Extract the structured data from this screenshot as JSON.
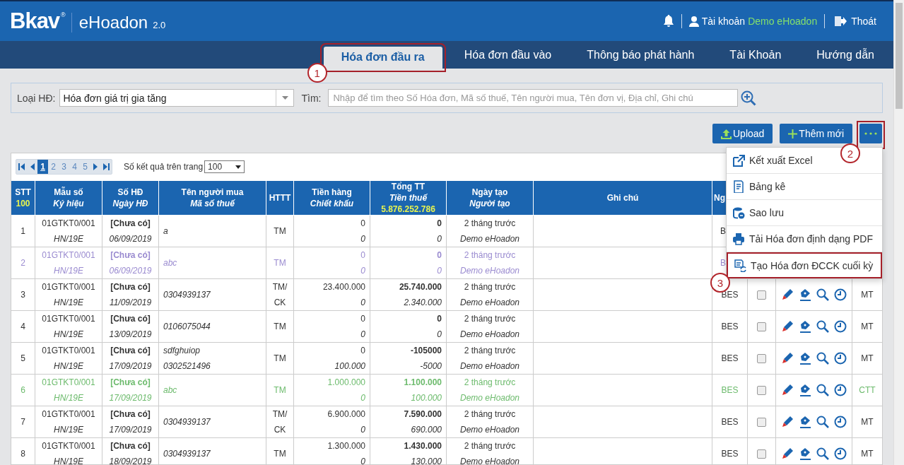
{
  "header": {
    "logo": {
      "brand": "Bkav",
      "mark": "®",
      "product": "eHoadon",
      "version": "2.0"
    },
    "account_label": "Tài khoản",
    "account_name": "Demo eHoadon",
    "logout": "Thoát"
  },
  "tabs": [
    {
      "label": "Hóa đơn đầu ra",
      "selected": true,
      "highlighted": true,
      "callout": "1"
    },
    {
      "label": "Hóa đơn đầu vào",
      "selected": false,
      "highlighted": false
    },
    {
      "label": "Thông báo phát hành",
      "selected": false,
      "highlighted": false
    },
    {
      "label": "Tài Khoản",
      "selected": false,
      "highlighted": false
    },
    {
      "label": "Hướng dẫn",
      "selected": false,
      "highlighted": false
    }
  ],
  "filter": {
    "type_label": "Loại HĐ:",
    "type_value": "Hóa đơn giá trị gia tăng",
    "search_label": "Tìm:",
    "search_placeholder": "Nhập để tìm theo Số Hóa đơn, Mã số thuế, Tên người mua, Tên đơn vị, Địa chỉ, Ghi chú"
  },
  "actions": [
    {
      "kind": "upload",
      "label": "Upload"
    },
    {
      "kind": "add",
      "label": "Thêm mới"
    },
    {
      "kind": "more",
      "highlighted": true,
      "callout": "2"
    }
  ],
  "menu": [
    {
      "kind": "export",
      "label": "Kết xuất Excel",
      "highlighted": false
    },
    {
      "kind": "list",
      "label": "Bảng kê",
      "highlighted": false
    },
    {
      "kind": "backup",
      "label": "Sao lưu",
      "highlighted": false
    },
    {
      "kind": "print",
      "label": "Tải Hóa đơn định dạng PDF",
      "highlighted": false
    },
    {
      "kind": "refresh",
      "label": "Tạo Hóa đơn ĐCCK cuối kỳ",
      "highlighted": true,
      "callout": "3"
    }
  ],
  "pager": {
    "pages": [
      {
        "label": "1",
        "selected": true
      },
      {
        "label": "2",
        "selected": false
      },
      {
        "label": "3",
        "selected": false
      },
      {
        "label": "4",
        "selected": false
      },
      {
        "label": "5",
        "selected": false
      }
    ],
    "page_size_label": "Số kết quả trên trang",
    "page_size": "100"
  },
  "table": {
    "columns": [
      {
        "title": "STT",
        "total": "100"
      },
      {
        "title": "Mẫu số",
        "subtitle": "Ký hiệu"
      },
      {
        "title": "Số HĐ",
        "subtitle": "Ngày HĐ"
      },
      {
        "title": "Tên người mua",
        "subtitle": "Mã số thuế"
      },
      {
        "title": "HTTT"
      },
      {
        "title": "Tiền hàng",
        "subtitle": "Chiết khấu"
      },
      {
        "title": "Tổng TT",
        "subtitle": "Tiền thuế",
        "total": "5.876.252.786"
      },
      {
        "title": "Ngày tạo",
        "subtitle": "Người tạo"
      },
      {
        "title": "Ghi chú"
      },
      {
        "title": "Ng"
      }
    ],
    "rows": [
      {
        "color": "#333333",
        "stt": "1",
        "mau_so": "01GTKT0/001",
        "ky_hieu": "HN/19E",
        "so_hd": "[Chưa có]",
        "ngay_hd": "06/09/2019",
        "ten_nguoi_mua": "a",
        "httt": [
          "TM"
        ],
        "tien_hang": "0",
        "chiet_khau": "0",
        "tong_tt": "0",
        "tien_thue": "0",
        "ngay_tao": "2 tháng trước",
        "nguoi_tao": "Demo eHoadon",
        "column_10": "B"
      },
      {
        "color": "#9a8bd0",
        "stt": "2",
        "mau_so": "01GTKT0/001",
        "ky_hieu": "HN/19E",
        "so_hd": "[Chưa có]",
        "ngay_hd": "06/09/2019",
        "ten_nguoi_mua": "abc",
        "httt": [
          "TM"
        ],
        "tien_hang": "0",
        "chiet_khau": "0",
        "tong_tt": "0",
        "tien_thue": "0",
        "ngay_tao": "2 tháng trước",
        "nguoi_tao": "Demo eHoadon",
        "column_10": "B"
      },
      {
        "color": "#333333",
        "stt": "3",
        "mau_so": "01GTKT0/001",
        "ky_hieu": "HN/19E",
        "so_hd": "[Chưa có]",
        "ngay_hd": "11/09/2019",
        "ma_so_thue": "0304939137",
        "httt": [
          "TM/",
          "CK"
        ],
        "tien_hang": "23.400.000",
        "chiet_khau": "0",
        "tong_tt": "25.740.000",
        "tien_thue": "2.340.000",
        "ngay_tao": "2 tháng trước",
        "nguoi_tao": "Demo eHoadon",
        "column_10": "BES",
        "checked": false,
        "tools": true,
        "column_13": "MT"
      },
      {
        "color": "#333333",
        "stt": "4",
        "mau_so": "01GTKT0/001",
        "ky_hieu": "HN/19E",
        "so_hd": "[Chưa có]",
        "ngay_hd": "13/09/2019",
        "ma_so_thue": "0106075044",
        "httt": [
          "TM"
        ],
        "tien_hang": "0",
        "chiet_khau": "0",
        "tong_tt": "0",
        "tien_thue": "0",
        "ngay_tao": "2 tháng trước",
        "nguoi_tao": "Demo eHoadon",
        "column_10": "BES",
        "checked": false,
        "tools": true,
        "column_13": "MT"
      },
      {
        "color": "#333333",
        "stt": "5",
        "mau_so": "01GTKT0/001",
        "ky_hieu": "HN/19E",
        "so_hd": "[Chưa có]",
        "ngay_hd": "17/09/2019",
        "ten_nguoi_mua": "sdfghuiop",
        "ma_so_thue": "0302521496",
        "httt": [
          "TM"
        ],
        "tien_hang": "0",
        "chiet_khau": "100.000",
        "tong_tt": "-105000",
        "tien_thue": "-5000",
        "ngay_tao": "2 tháng trước",
        "nguoi_tao": "Demo eHoadon",
        "column_10": "BES",
        "checked": false,
        "tools": true,
        "column_13": "MT"
      },
      {
        "color": "#6dbb6d",
        "stt": "6",
        "mau_so": "01GTKT0/001",
        "ky_hieu": "HN/19E",
        "so_hd": "[Chưa có]",
        "ngay_hd": "17/09/2019",
        "ten_nguoi_mua": "abc",
        "httt": [
          "TM"
        ],
        "tien_hang": "1.000.000",
        "chiet_khau": "0",
        "tong_tt": "1.100.000",
        "tien_thue": "100.000",
        "ngay_tao": "2 tháng trước",
        "nguoi_tao": "Demo eHoadon",
        "column_10": "BES",
        "checked": false,
        "tools": true,
        "column_13": "CTT"
      },
      {
        "color": "#333333",
        "stt": "7",
        "mau_so": "01GTKT0/001",
        "ky_hieu": "HN/19E",
        "so_hd": "[Chưa có]",
        "ngay_hd": "17/09/2019",
        "ma_so_thue": "0304939137",
        "httt": [
          "TM/",
          "CK"
        ],
        "tien_hang": "6.900.000",
        "chiet_khau": "0",
        "tong_tt": "7.590.000",
        "tien_thue": "690.000",
        "ngay_tao": "2 tháng trước",
        "nguoi_tao": "Demo eHoadon",
        "column_10": "BES",
        "checked": false,
        "tools": true,
        "column_13": "MT"
      },
      {
        "color": "#333333",
        "stt": "8",
        "mau_so": "01GTKT0/001",
        "ky_hieu": "HN/19E",
        "so_hd": "[Chưa có]",
        "ngay_hd": "18/09/2019",
        "ma_so_thue": "0304939137",
        "httt": [
          "TM"
        ],
        "tien_hang": "1.300.000",
        "chiet_khau": "0",
        "tong_tt": "1.430.000",
        "tien_thue": "130.000",
        "ngay_tao": "2 tháng trước",
        "nguoi_tao": "Demo eHoadon",
        "column_10": "BES",
        "checked": false,
        "tools": true,
        "column_13": "MT"
      }
    ]
  }
}
